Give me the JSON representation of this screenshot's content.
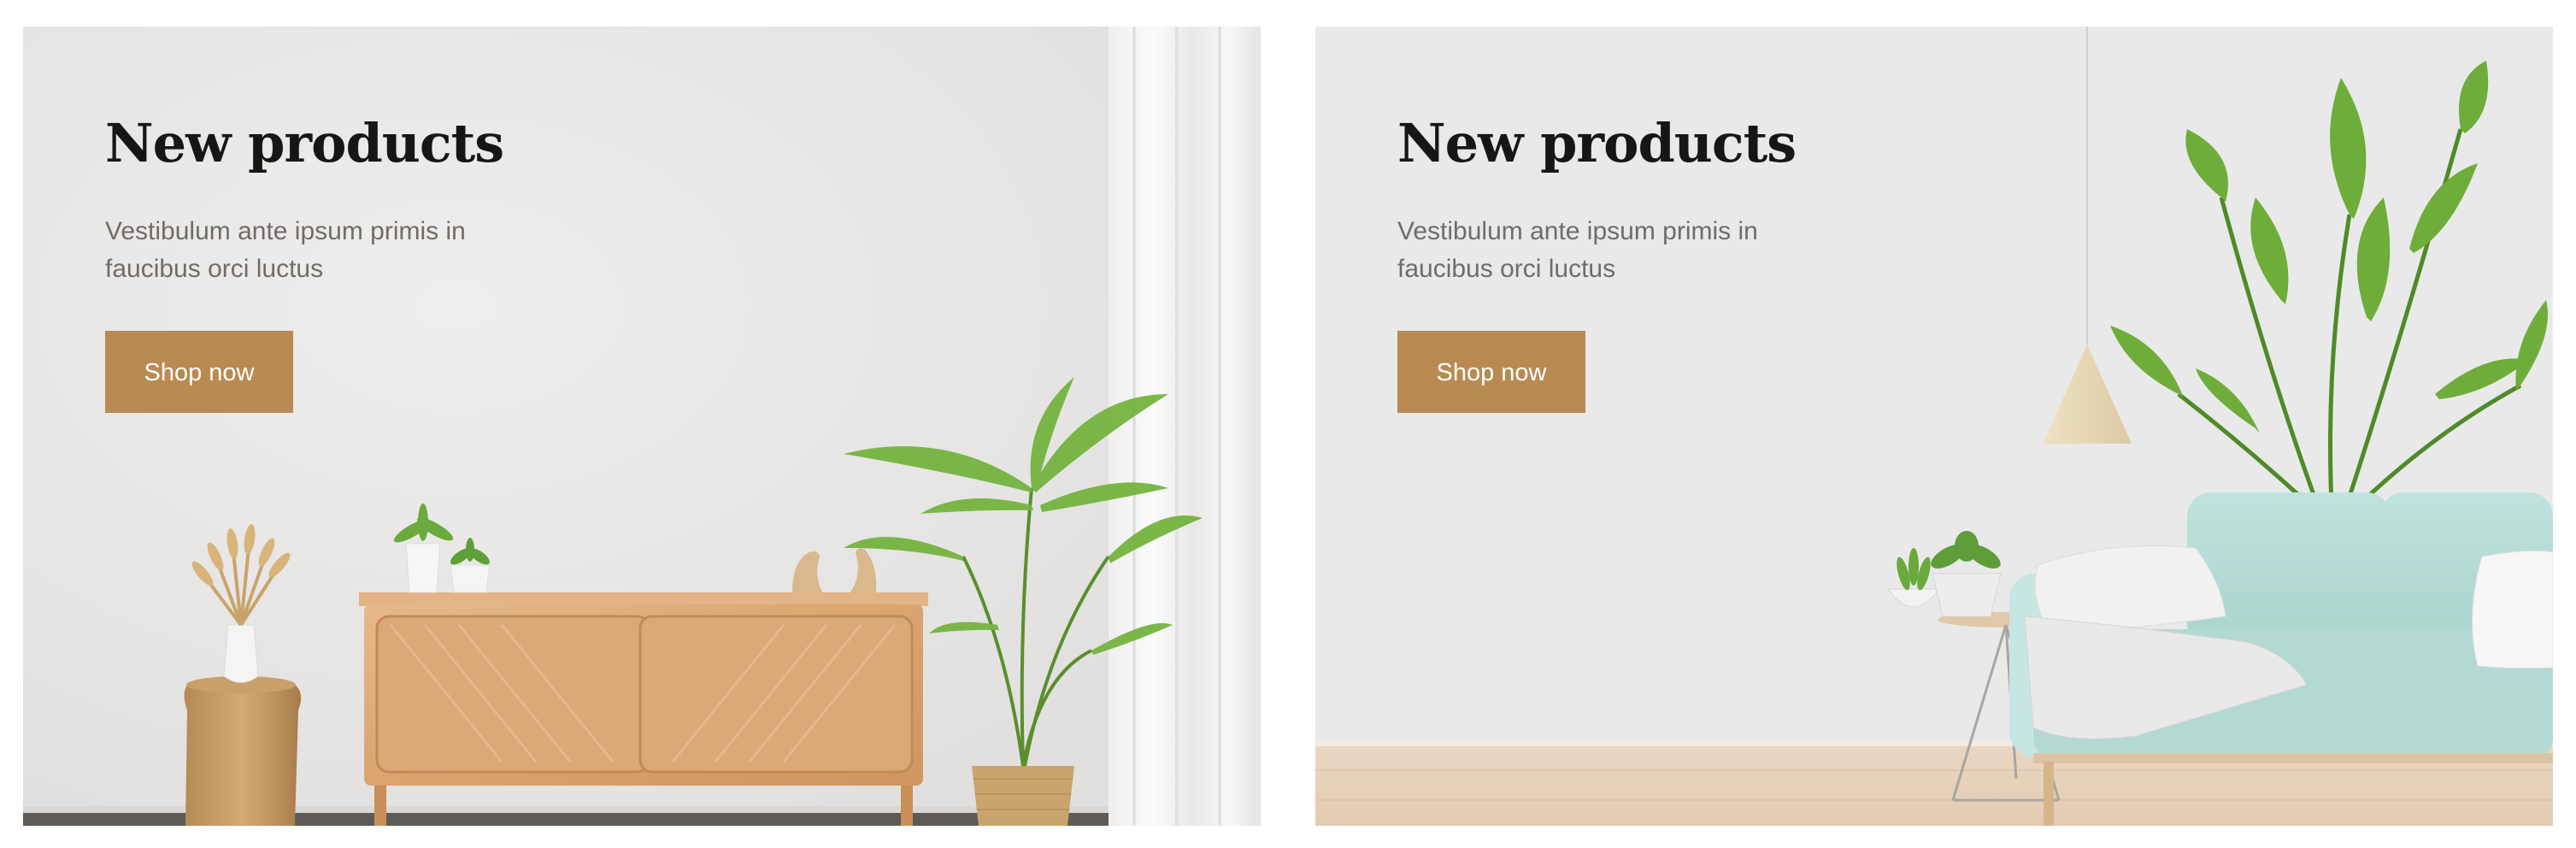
{
  "banners": [
    {
      "title": "New products",
      "description": "Vestibulum ante ipsum primis in faucibus orci luctus",
      "button_label": "Shop now",
      "scene": "living room with wooden sideboard, palm plant and white curtain"
    },
    {
      "title": "New products",
      "description": "Vestibulum ante ipsum primis in faucibus orci luctus",
      "button_label": "Shop now",
      "scene": "living room with mint sofa, pendant lamp and large plant"
    }
  ],
  "colors": {
    "button_background": "#b98a52",
    "button_text": "#ffffff",
    "title": "#181614",
    "description": "#6f6c69"
  }
}
